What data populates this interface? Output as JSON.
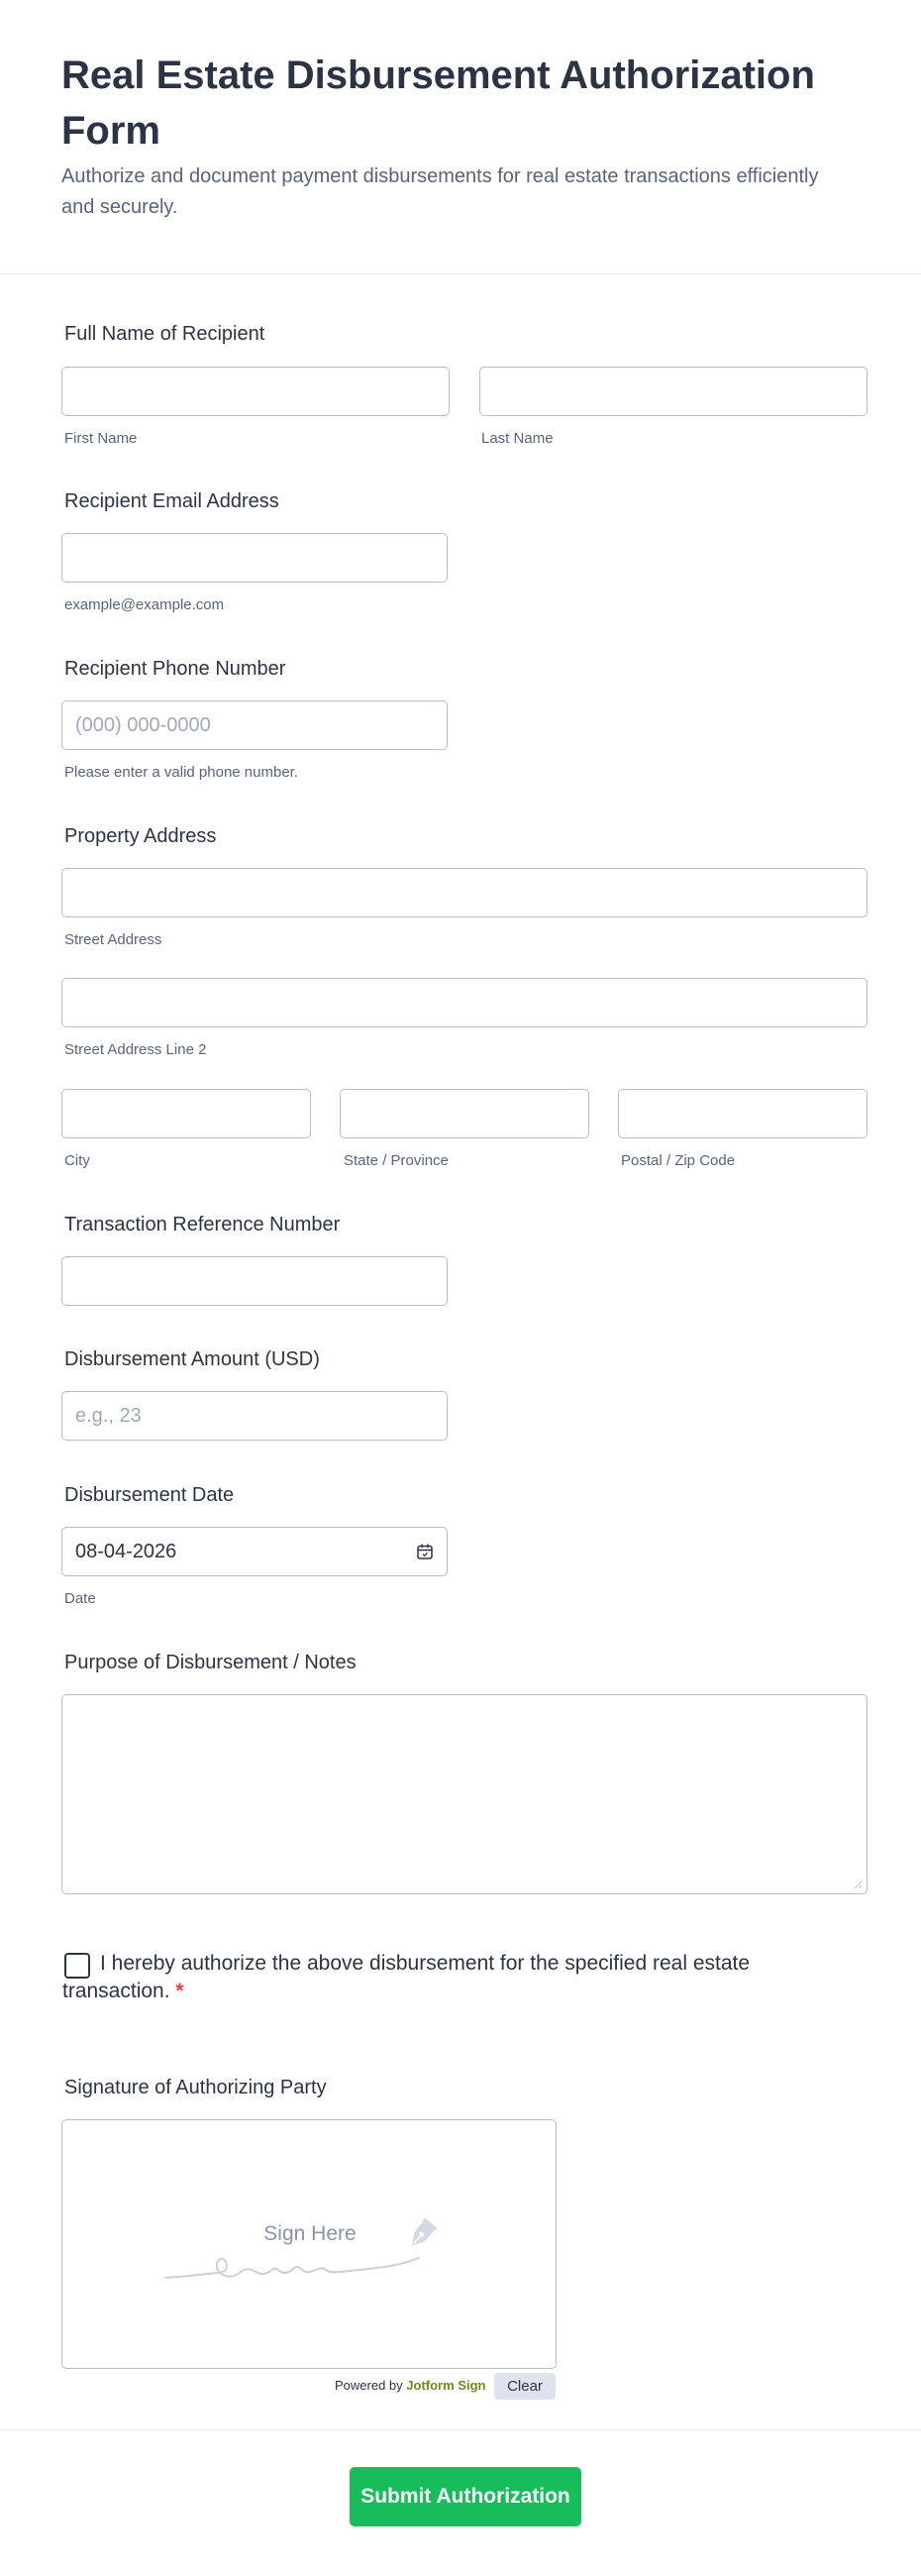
{
  "header": {
    "title": "Real Estate Disbursement Authorization Form",
    "subtitle": "Authorize and document payment disbursements for real estate transactions efficiently and securely."
  },
  "recipient_name": {
    "label": "Full Name of Recipient",
    "first_sublabel": "First Name",
    "last_sublabel": "Last Name",
    "first_value": "",
    "last_value": ""
  },
  "email": {
    "label": "Recipient Email Address",
    "sublabel": "example@example.com",
    "value": ""
  },
  "phone": {
    "label": "Recipient Phone Number",
    "placeholder": "(000) 000-0000",
    "sublabel": "Please enter a valid phone number."
  },
  "address": {
    "label": "Property Address",
    "street_sublabel": "Street Address",
    "street2_sublabel": "Street Address Line 2",
    "city_sublabel": "City",
    "state_sublabel": "State / Province",
    "zip_sublabel": "Postal / Zip Code"
  },
  "reference": {
    "label": "Transaction Reference Number",
    "value": ""
  },
  "amount": {
    "label": "Disbursement Amount (USD)",
    "placeholder": "e.g., 23"
  },
  "date": {
    "label": "Disbursement Date",
    "value": "08-04-2026",
    "sublabel": "Date",
    "icon": "calendar-icon"
  },
  "notes": {
    "label": "Purpose of Disbursement / Notes",
    "value": ""
  },
  "consent": {
    "text": "I hereby authorize the above disbursement for the specified real estate transaction.",
    "required_mark": "*",
    "checked": false
  },
  "signature": {
    "label": "Signature of Authorizing Party",
    "placeholder": "Sign Here",
    "powered_prefix": "Powered by",
    "powered_brand": "Jotform Sign",
    "clear_label": "Clear",
    "icon": "pen-nib-icon"
  },
  "submit": {
    "label": "Submit Authorization"
  },
  "colors": {
    "accent": "#18bd5b",
    "text": "#2c3345",
    "muted": "#57647e",
    "border": "#b8bdc9",
    "required": "#f23a3c",
    "brand": "#6d8a1f"
  }
}
